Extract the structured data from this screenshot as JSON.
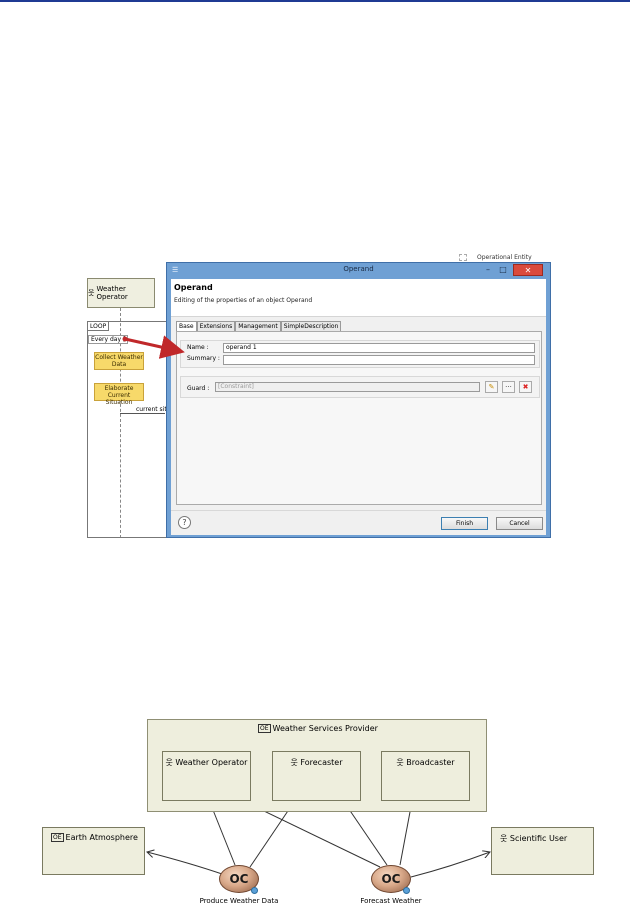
{
  "diagram1": {
    "actor": "Weather Operator",
    "loop_tag": "LOOP",
    "guard_text": "Every day ]",
    "activities": [
      "Collect Weather Data",
      "Elaborate Current Situation"
    ],
    "message": "current siti",
    "operational_entity_label": "Operational Entity"
  },
  "dialog": {
    "window_title": "Operand",
    "header_title": "Operand",
    "header_subtitle": "Editing of the properties of an object Operand",
    "tabs": [
      "Base",
      "Extensions",
      "Management",
      "SimpleDescription"
    ],
    "name_label": "Name :",
    "name_value": "operand 1",
    "summary_label": "Summary :",
    "summary_value": "",
    "guard_label": "Guard :",
    "guard_placeholder": "[Constraint]",
    "help_symbol": "?",
    "finish_label": "Finish",
    "cancel_label": "Cancel",
    "window_buttons": {
      "minimize": "–",
      "maximize": "□",
      "close": "✕"
    }
  },
  "diagram2": {
    "container_icon": "OE",
    "container_title": "Weather Services Provider",
    "roles": [
      "Weather Operator",
      "Forecaster",
      "Broadcaster"
    ],
    "external_entities": {
      "earth_icon": "OE",
      "earth": "Earth Atmosphere",
      "scientific": "Scientific User"
    },
    "capabilities": [
      {
        "symbol": "OC",
        "label": "Produce Weather Data"
      },
      {
        "symbol": "OC",
        "label": "Forecast Weather"
      }
    ]
  },
  "colors": {
    "title_bar": "#6fa0d4",
    "close_button": "#d94a3c",
    "activity_fill": "#f7d96a",
    "entity_fill": "#eeeedd",
    "arrow_red": "#c0282a"
  }
}
